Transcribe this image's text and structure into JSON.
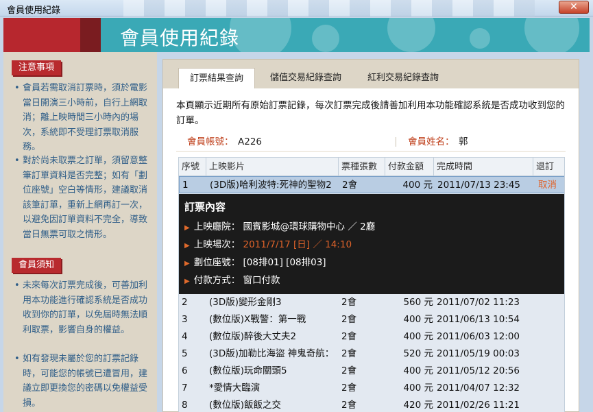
{
  "window": {
    "title": "會員使用紀錄",
    "close_glyph": "✕"
  },
  "banner": {
    "title": "會員使用紀錄"
  },
  "sidebar": {
    "notice": {
      "heading": "注意事項",
      "items": [
        "會員若需取消訂票時，須於電影當日開演三小時前，自行上網取消；離上映時間三小時內的場次，系統即不受理訂票取消服務。",
        "對於尚未取票之訂單，須留意整筆訂單資料是否完整；如有「劃位座號」空白等情形，建議取消該筆訂單，重新上網再訂一次，以避免因訂單資料不完全，導致當日無票可取之情形。"
      ]
    },
    "rules": {
      "heading": "會員須知",
      "items": [
        "未來每次訂票完成後，可善加利用本功能進行確認系統是否成功收到你的訂單，以免屆時無法順利取票，影響自身的權益。",
        "如有發現未屬於您的訂票記錄時，可能您的帳號已遭冒用，建議立即更換您的密碼以免權益受損。"
      ]
    }
  },
  "tabs": [
    "訂票結果查詢",
    "儲值交易紀錄查詢",
    "紅利交易紀錄查詢"
  ],
  "intro": "本頁顯示近期所有原始訂票記錄，每次訂票完成後請善加利用本功能確認系統是否成功收到您的訂單。",
  "member": {
    "account_label": "會員帳號：",
    "account": "A226",
    "name_label": "會員姓名：",
    "name": "郭"
  },
  "table": {
    "headers": [
      "序號",
      "上映影片",
      "票種張數",
      "付款金額",
      "完成時間",
      "退訂"
    ],
    "rows": [
      {
        "no": "1",
        "film": "(3D版)哈利波特:死神的聖物2",
        "tickets": "2會",
        "amount": "400 元",
        "time": "2011/07/13 23:45",
        "action": "取消"
      },
      {
        "no": "2",
        "film": "(3D版)變形金剛3",
        "tickets": "2會",
        "amount": "560 元",
        "time": "2011/07/02 11:23",
        "action": ""
      },
      {
        "no": "3",
        "film": "(數位版)X戰警：第一戰",
        "tickets": "2會",
        "amount": "400 元",
        "time": "2011/06/13 10:54",
        "action": ""
      },
      {
        "no": "4",
        "film": "(數位版)醉後大丈夫2",
        "tickets": "2會",
        "amount": "400 元",
        "time": "2011/06/03 12:00",
        "action": ""
      },
      {
        "no": "5",
        "film": "(3D版)加勒比海盜 神鬼奇航：",
        "tickets": "2會",
        "amount": "520 元",
        "time": "2011/05/19 00:03",
        "action": ""
      },
      {
        "no": "6",
        "film": "(數位版)玩命關頭5",
        "tickets": "2會",
        "amount": "400 元",
        "time": "2011/05/12 20:56",
        "action": ""
      },
      {
        "no": "7",
        "film": "*愛情大臨演",
        "tickets": "2會",
        "amount": "400 元",
        "time": "2011/04/07 12:32",
        "action": ""
      },
      {
        "no": "8",
        "film": "(數位版)飯飯之交",
        "tickets": "2會",
        "amount": "420 元",
        "time": "2011/02/26 11:21",
        "action": ""
      }
    ]
  },
  "detail": {
    "heading": "訂票內容",
    "lines": [
      {
        "label": "上映廳院：",
        "value": "國賓影城@環球購物中心 ／ 2廳"
      },
      {
        "label": "上映場次：",
        "value": "2011/7/17 [日] ／ 14:10"
      },
      {
        "label": "劃位座號：",
        "value": "[08排01] [08排03]"
      },
      {
        "label": "付款方式：",
        "value": "窗口付款"
      }
    ]
  },
  "colors": {
    "brand_red": "#b7272e",
    "banner_teal": "#3aa9b6",
    "link_orange": "#e0632a",
    "sidebar_text": "#2f5e88"
  }
}
